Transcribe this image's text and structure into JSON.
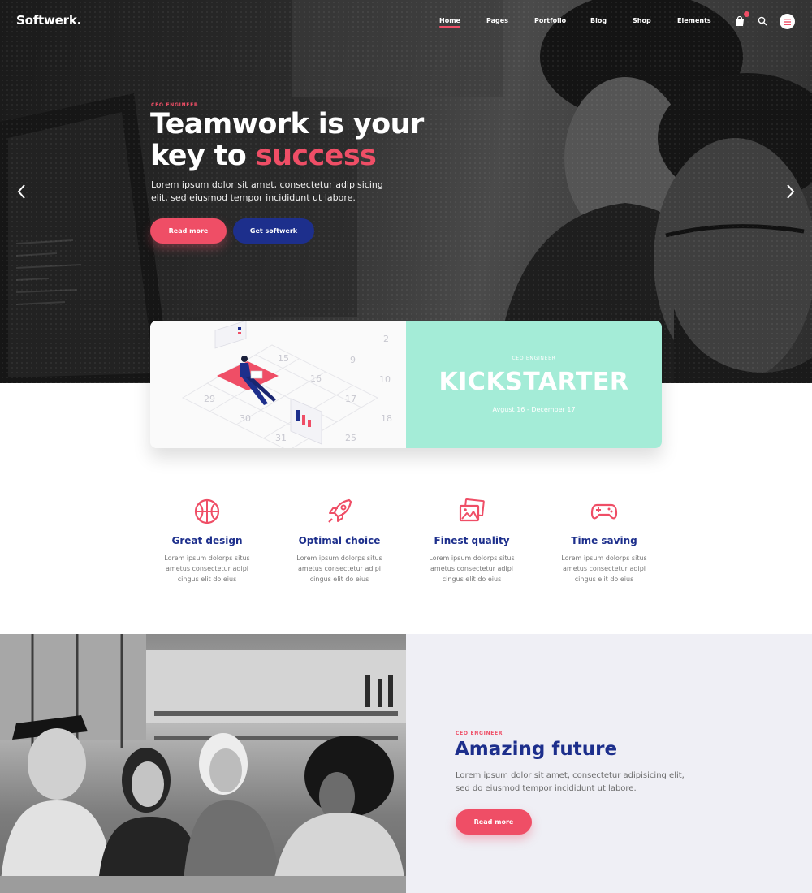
{
  "nav": {
    "logo": "Softwerk.",
    "items": [
      "Home",
      "Pages",
      "Portfolio",
      "Blog",
      "Shop",
      "Elements"
    ],
    "icons": [
      "cart-icon",
      "search-icon",
      "menu-icon"
    ]
  },
  "hero": {
    "eyebrow": "CEO ENGINEER",
    "title_line1": "Teamwork is your",
    "title_line2_plain": "key to ",
    "title_line2_accent": "success",
    "text": "Lorem ipsum dolor sit amet, consectetur adipisicing elit, sed eiusmod tempor incididunt ut labore.",
    "primary_button": "Read more",
    "secondary_button": "Get softwerk"
  },
  "kickstarter": {
    "eyebrow": "CEO ENGINEER",
    "title": "KICKSTARTER",
    "date": "Avgust 16 - December 17",
    "calendar_numbers": [
      "2",
      "15",
      "9",
      "16",
      "10",
      "29",
      "17",
      "30",
      "18",
      "31",
      "25"
    ]
  },
  "features": [
    {
      "icon": "basketball-icon",
      "title": "Great design",
      "text": "Lorem ipsum dolorps situs ametus consectetur adipi cingus elit do eius"
    },
    {
      "icon": "rocket-icon",
      "title": "Optimal choice",
      "text": "Lorem ipsum dolorps situs ametus consectetur adipi cingus elit do eius"
    },
    {
      "icon": "images-icon",
      "title": "Finest quality",
      "text": "Lorem ipsum dolorps situs ametus consectetur adipi cingus elit do eius"
    },
    {
      "icon": "gamepad-icon",
      "title": "Time saving",
      "text": "Lorem ipsum dolorps situs ametus consectetur adipi cingus elit do eius"
    }
  ],
  "future": {
    "eyebrow": "CEO ENGINEER",
    "title": "Amazing future",
    "text": "Lorem ipsum dolor sit amet, consectetur adipisicing elit, sed do eiusmod tempor incididunt ut labore.",
    "button": "Read more"
  },
  "colors": {
    "accent": "#ef4e66",
    "brand_blue": "#1d2f8c",
    "kickstarter_mint": "#a4ecd7",
    "section_gray": "#efeff5"
  }
}
